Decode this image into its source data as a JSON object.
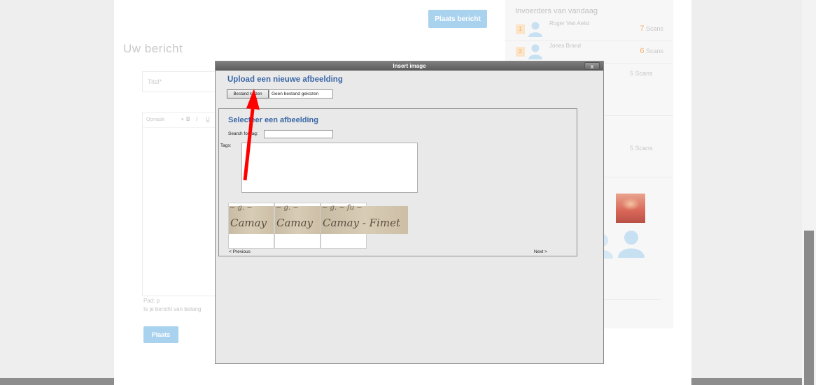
{
  "background_page": {
    "post_button_top": "Plaats bericht",
    "title": "Uw bericht",
    "title_placeholder": "Titel*",
    "editor": {
      "format_label": "Opmaak",
      "bold": "B",
      "italic": "I",
      "underline": "U"
    },
    "path_label": "Pad: p",
    "important_label": "Is je bericht van belang",
    "post_button": "Plaats"
  },
  "right_panel": {
    "heading": "Invoerders van vandaag",
    "rankings": [
      {
        "rank": "1",
        "name": "Roger Van Aelst",
        "count": "7",
        "unit": "Scans"
      },
      {
        "rank": "2",
        "name": "Jones Brand",
        "count": "6",
        "unit": "Scans"
      }
    ],
    "other_scans": [
      "5 Scans",
      "5 Scans"
    ]
  },
  "dialog": {
    "title": "Insert image",
    "close_label": "x",
    "upload_title": "Upload een nieuwe afbeelding",
    "choose_file_button": "Bestand kiezen",
    "no_file_text": "Geen bestand gekozen",
    "select_title": "Selecteer een afbeelding",
    "search_label": "Search for tag:",
    "search_value": "",
    "tags_label": "Tags:",
    "thumbnails": [
      {
        "script": "Camay"
      },
      {
        "script": "Camay"
      },
      {
        "script": "Camay - Fimet"
      }
    ],
    "prev_link": "< Previous",
    "next_link": "Next >"
  },
  "colors": {
    "accent_blue": "#3b67a7",
    "button_blue": "#a9d2ef",
    "rank_orange": "#f3b46e",
    "annotation_arrow": "#ff0000"
  },
  "icons": {
    "close": "close-icon",
    "avatar": "user-avatar-icon",
    "arrow": "annotation-arrow"
  }
}
